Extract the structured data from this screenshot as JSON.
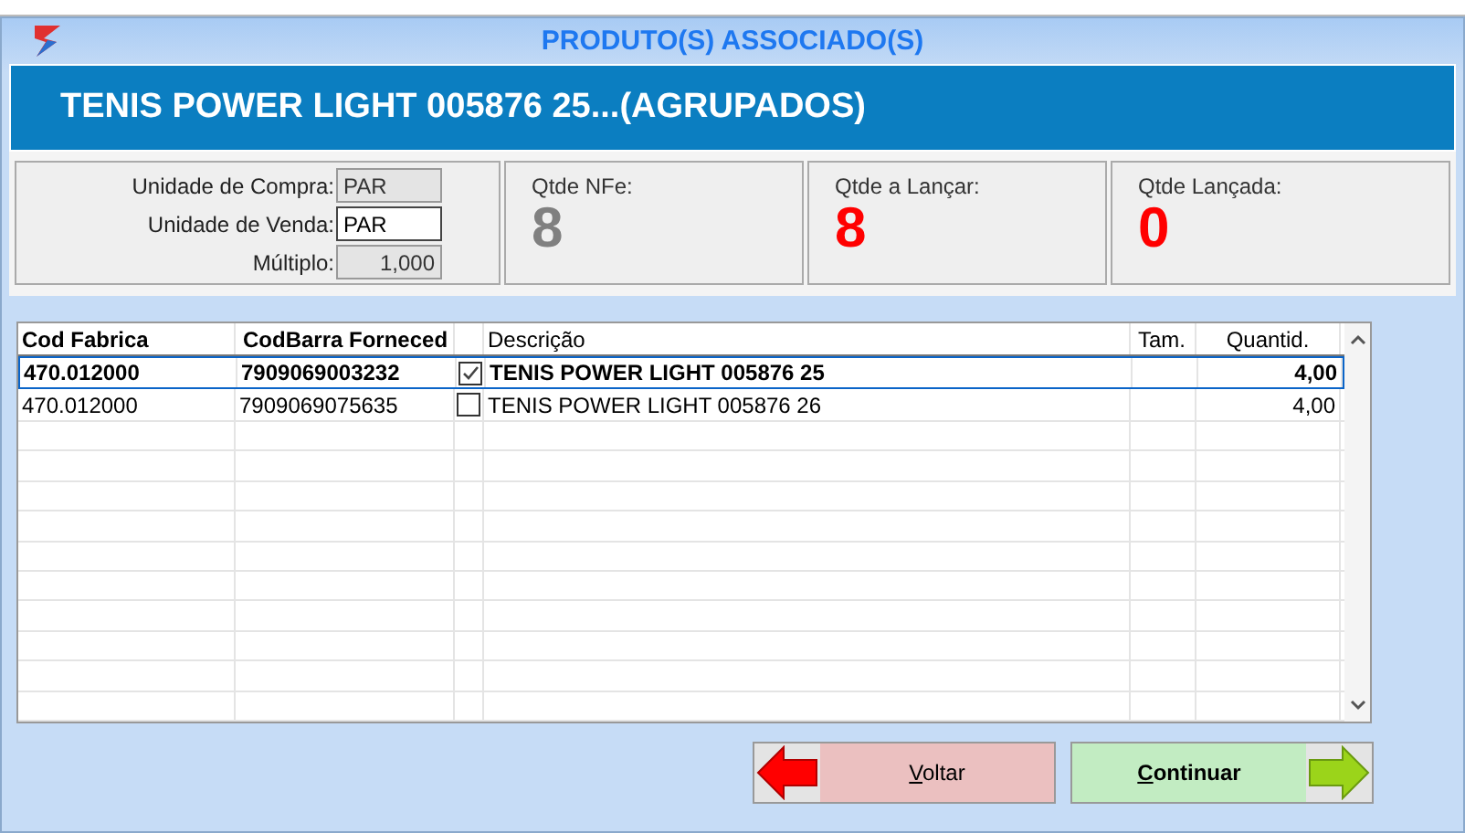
{
  "window": {
    "title": "PRODUTO(S) ASSOCIADO(S)"
  },
  "header": {
    "title": "TENIS POWER LIGHT 005876 25...(AGRUPADOS)"
  },
  "units": [
    {
      "label": "Unidade de Compra:",
      "value": "PAR",
      "editable": false,
      "kind": "text"
    },
    {
      "label": "Unidade de Venda:",
      "value": "PAR",
      "editable": true,
      "kind": "text"
    },
    {
      "label": "Múltiplo:",
      "value": "1,000",
      "editable": false,
      "kind": "number"
    }
  ],
  "counters": [
    {
      "label": "Qtde NFe:",
      "value": "8",
      "color": "#808080"
    },
    {
      "label": "Qtde a Lançar:",
      "value": "8",
      "color": "#ff0000"
    },
    {
      "label": "Qtde Lançada:",
      "value": "0",
      "color": "#ff0000"
    }
  ],
  "table": {
    "columns": [
      "Cod Fabrica",
      "CodBarra Forneced",
      "",
      "Descrição",
      "Tam.",
      "Quantid."
    ],
    "rows": [
      {
        "cod_fabrica": "470.012000",
        "codbarra": "7909069003232",
        "checked": true,
        "descricao": "TENIS POWER LIGHT 005876 25",
        "quantid": "4,00",
        "selected": true
      },
      {
        "cod_fabrica": "470.012000",
        "codbarra": "7909069075635",
        "checked": false,
        "descricao": "TENIS POWER LIGHT 005876 26",
        "quantid": "4,00",
        "selected": false
      }
    ]
  },
  "buttons": [
    {
      "kind": "back",
      "label": "Voltar"
    },
    {
      "kind": "next",
      "label": "Continuar"
    }
  ]
}
